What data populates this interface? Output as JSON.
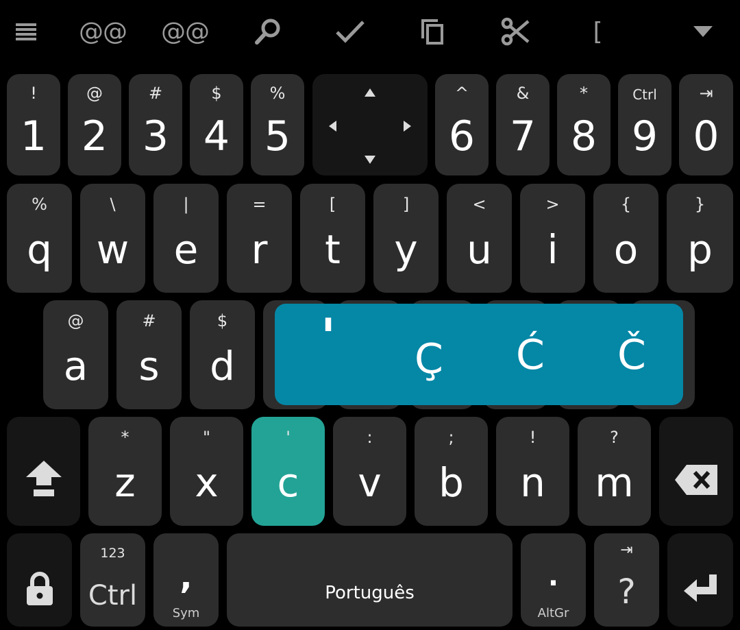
{
  "toolbar": {
    "menu_icon": "menu-icon",
    "clip1": "@@",
    "clip2": "@@",
    "search_icon": "search-icon",
    "check_icon": "check-icon",
    "copy_icon": "copy-icon",
    "cut_icon": "scissors-icon",
    "bracket": "[",
    "dropdown_icon": "chevron-down-icon"
  },
  "row1": [
    {
      "hint": "!",
      "main": "1"
    },
    {
      "hint": "@",
      "main": "2"
    },
    {
      "hint": "#",
      "main": "3"
    },
    {
      "hint": "$",
      "main": "4"
    },
    {
      "hint": "%",
      "main": "5"
    },
    {
      "hint": "^",
      "main": "6"
    },
    {
      "hint": "&",
      "main": "7"
    },
    {
      "hint": "*",
      "main": "8"
    },
    {
      "hint": "Ctrl",
      "main": "9"
    },
    {
      "hint": "⇥",
      "main": "0"
    }
  ],
  "row2": [
    {
      "hint": "%",
      "main": "q"
    },
    {
      "hint": "\\",
      "main": "w"
    },
    {
      "hint": "|",
      "main": "e"
    },
    {
      "hint": "=",
      "main": "r"
    },
    {
      "hint": "[",
      "main": "t"
    },
    {
      "hint": "]",
      "main": "y"
    },
    {
      "hint": "<",
      "main": "u"
    },
    {
      "hint": ">",
      "main": "i"
    },
    {
      "hint": "{",
      "main": "o"
    },
    {
      "hint": "}",
      "main": "p"
    }
  ],
  "row3": [
    {
      "hint": "@",
      "main": "a"
    },
    {
      "hint": "#",
      "main": "s"
    },
    {
      "hint": "$",
      "main": "d"
    }
  ],
  "popup": {
    "apostrophe": "'",
    "c_cedilla": "Ç",
    "c_acute": "Ć",
    "c_caron": "Č"
  },
  "row4": [
    {
      "hint": "*",
      "main": "z"
    },
    {
      "hint": "\"",
      "main": "x"
    },
    {
      "hint": "'",
      "main": "c"
    },
    {
      "hint": ":",
      "main": "v"
    },
    {
      "hint": ";",
      "main": "b"
    },
    {
      "hint": "!",
      "main": "n"
    },
    {
      "hint": "?",
      "main": "m"
    }
  ],
  "row5": {
    "ctrl_hint": "123",
    "ctrl_label": "Ctrl",
    "comma": ",",
    "sym_label": "Sym",
    "space_label": "Português",
    "period": ".",
    "altgr_label": "AltGr",
    "question": "?",
    "tab_hint": "⇥"
  },
  "colors": {
    "key": "#2d2d2d",
    "key_dark": "#161616",
    "active_key": "#23a396",
    "popup": "#0587a6",
    "toolbar_icon": "#9a9a9a"
  }
}
